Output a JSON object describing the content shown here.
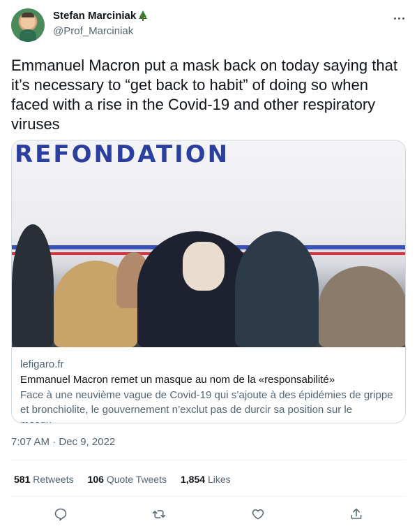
{
  "author": {
    "display_name": "Stefan Marciniak",
    "handle": "@Prof_Marciniak"
  },
  "tweet": {
    "text": "Emmanuel Macron put a mask back on today saying that it’s necessary to “get back to habit” of doing so when faced with a rise in the Covid-19 and other respiratory viruses",
    "timestamp": "7:07 AM · Dec 9, 2022"
  },
  "card": {
    "image_banner_text": "REFONDATION",
    "domain": "lefigaro.fr",
    "title": "Emmanuel Macron remet un masque au nom de la «responsabilité»",
    "description": "Face à une neuvième vague de Covid-19 qui s’ajoute à des épidémies de grippe et bronchiolite, le gouvernement n’exclut pas de durcir sa position sur le masqu…"
  },
  "stats": {
    "retweets_count": "581",
    "retweets_label": "Retweets",
    "quotes_count": "106",
    "quotes_label": "Quote Tweets",
    "likes_count": "1,854",
    "likes_label": "Likes"
  },
  "icons": {
    "reply": "reply-icon",
    "retweet": "retweet-icon",
    "like": "like-icon",
    "share": "share-icon",
    "more": "more-icon"
  },
  "colors": {
    "text_primary": "#0f1419",
    "text_secondary": "#536471",
    "border": "#cfd9de"
  }
}
